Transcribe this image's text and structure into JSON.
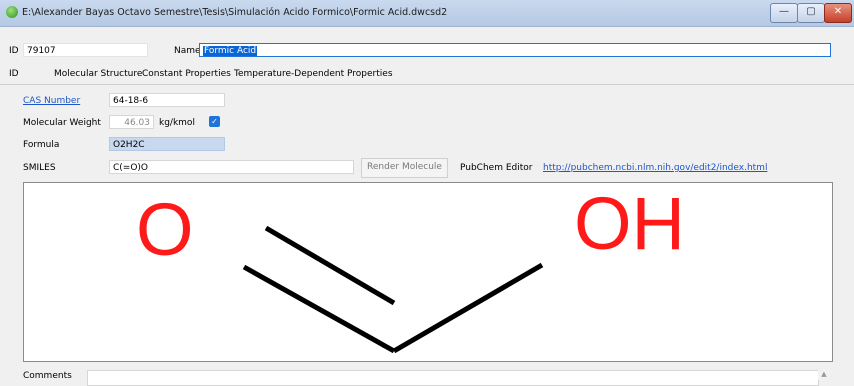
{
  "window": {
    "title": "E:\\Alexander Bayas Octavo Semestre\\Tesis\\Simulación Acido Formico\\Formic Acid.dwcsd2",
    "btn_min": "—",
    "btn_max": "▢",
    "btn_close": "✕"
  },
  "header": {
    "id_label": "ID",
    "id_value": "79107",
    "name_label": "Name",
    "name_value": "Formic Acid"
  },
  "tabs": [
    {
      "label": "ID"
    },
    {
      "label": "Molecular Structure"
    },
    {
      "label": "Constant Properties"
    },
    {
      "label": "Temperature-Dependent Properties"
    }
  ],
  "form": {
    "cas_label": "CAS Number",
    "cas_value": "64-18-6",
    "mw_label": "Molecular Weight",
    "mw_value": "46.03",
    "mw_unit": "kg/kmol",
    "formula_label": "Formula",
    "formula_value": "O2H2C",
    "smiles_label": "SMILES",
    "smiles_value": "C(=O)O",
    "render_button": "Render Molecule",
    "pubchem_label": "PubChem Editor",
    "pubchem_link": "http://pubchem.ncbi.nlm.nih.gov/edit2/index.html"
  },
  "molecule": {
    "atom_left": "O",
    "atom_right": "OH"
  },
  "comments_label": "Comments",
  "colors": {
    "accent": "#0a66d6",
    "atom": "#ff1a1a",
    "link": "#1f56c8"
  }
}
